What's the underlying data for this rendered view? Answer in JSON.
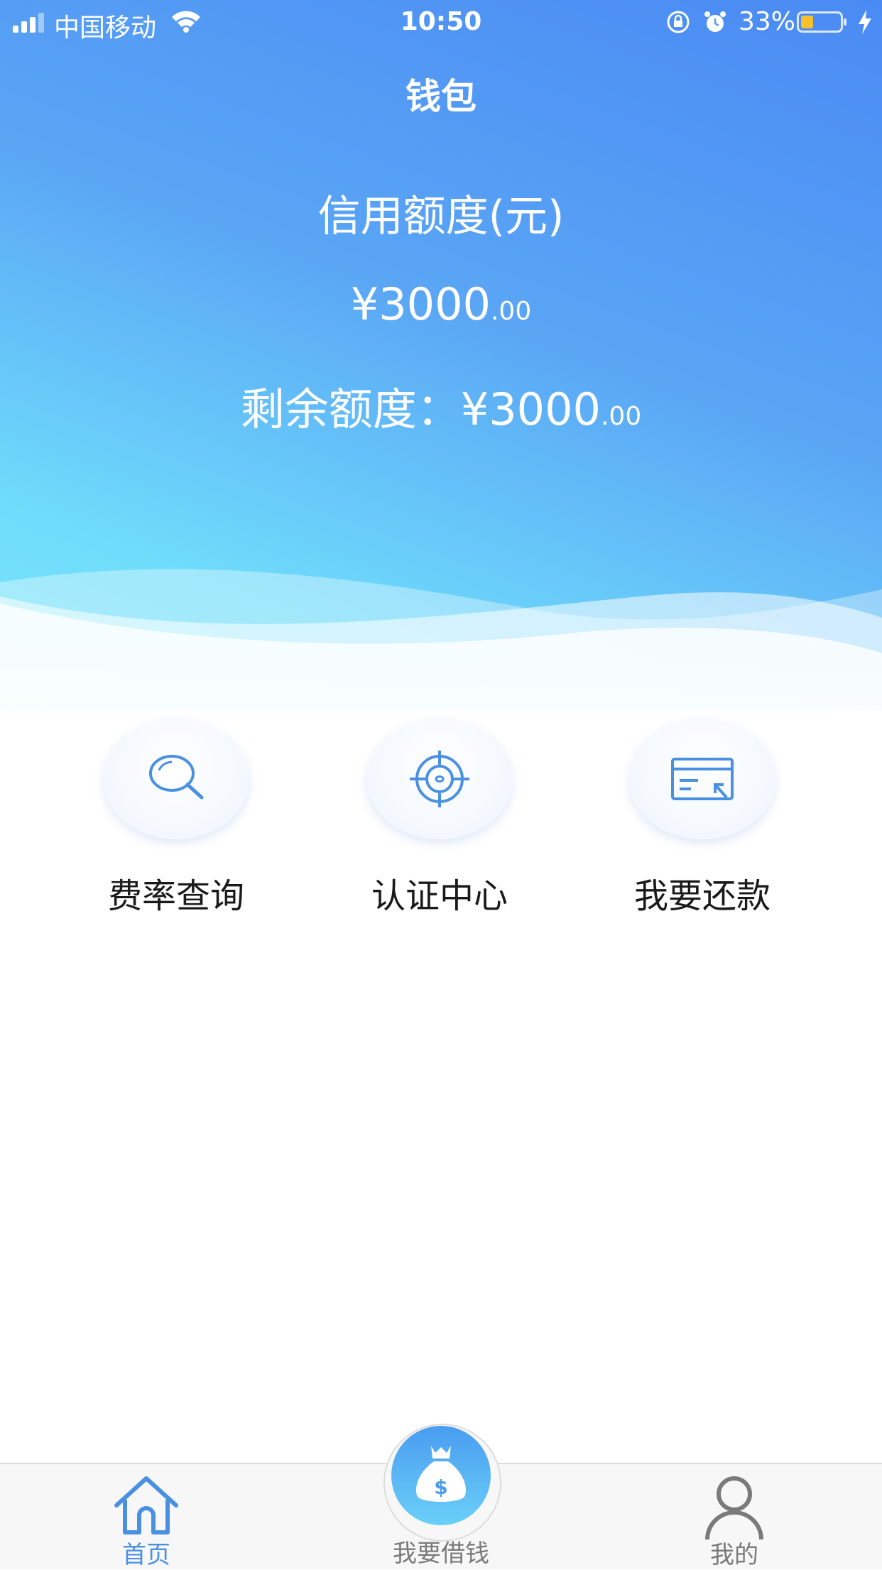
{
  "status_bar": {
    "carrier": "中国移动",
    "time": "10:50",
    "battery_percent": "33%",
    "battery_level": 0.33,
    "icons": [
      "signal-icon",
      "wifi-icon",
      "rotation-lock-icon",
      "alarm-icon",
      "battery-icon",
      "charging-icon"
    ]
  },
  "header": {
    "title": "钱包",
    "credit_label": "信用额度(元)",
    "credit_amount": "¥3000",
    "credit_cents": ".00",
    "remaining_prefix": "剩余额度：¥3000",
    "remaining_cents": ".00",
    "gradient_colors": [
      "#4a8af4",
      "#6fdcfb"
    ]
  },
  "actions": [
    {
      "label": "费率查询",
      "icon": "search-icon"
    },
    {
      "label": "认证中心",
      "icon": "target-icon"
    },
    {
      "label": "我要还款",
      "icon": "card-icon"
    }
  ],
  "tabbar": {
    "home": {
      "label": "首页",
      "icon": "home-icon"
    },
    "borrow": {
      "label": "我要借钱",
      "icon": "money-bag-icon"
    },
    "mine": {
      "label": "我的",
      "icon": "user-icon"
    },
    "active_color": "#4a90e2",
    "inactive_color": "#7a7a7a"
  }
}
